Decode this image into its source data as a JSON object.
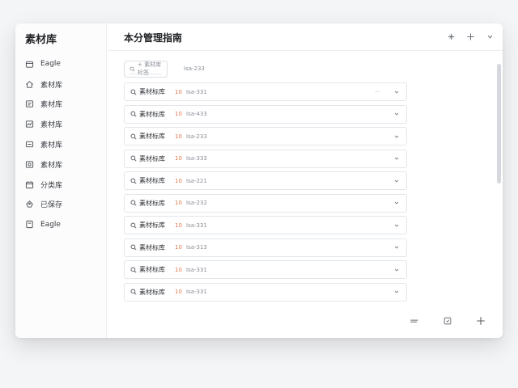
{
  "sidebar": {
    "title": "素材库",
    "items": [
      {
        "label": "Eagle",
        "icon": "folder-icon"
      },
      {
        "label": "素材库",
        "icon": "home-icon"
      },
      {
        "label": "素材库",
        "icon": "image-icon"
      },
      {
        "label": "素材库",
        "icon": "chart-icon"
      },
      {
        "label": "素材库",
        "icon": "archive-icon"
      },
      {
        "label": "素材库",
        "icon": "photo-icon"
      },
      {
        "label": "分类库",
        "icon": "calendar-icon"
      },
      {
        "label": "已保存",
        "icon": "tag-icon"
      },
      {
        "label": "Eagle",
        "icon": "document-icon"
      }
    ]
  },
  "header": {
    "title": "本分管理指南"
  },
  "filter": {
    "chip_label": "+ 素材库标签",
    "code": "Isa-233"
  },
  "rows": [
    {
      "name": "素材标库",
      "tag": "10",
      "code": "Isa-331",
      "ellipsis": "···"
    },
    {
      "name": "素材标库",
      "tag": "10",
      "code": "Isa-433",
      "ellipsis": ""
    },
    {
      "name": "素材标库",
      "tag": "10",
      "code": "Isa-233",
      "ellipsis": ""
    },
    {
      "name": "素材标库",
      "tag": "10",
      "code": "Isa-333",
      "ellipsis": ""
    },
    {
      "name": "素材标库",
      "tag": "10",
      "code": "Isa-221",
      "ellipsis": ""
    },
    {
      "name": "素材标库",
      "tag": "10",
      "code": "Isa-232",
      "ellipsis": ""
    },
    {
      "name": "素材标库",
      "tag": "10",
      "code": "Isa-331",
      "ellipsis": ""
    },
    {
      "name": "素材标库",
      "tag": "10",
      "code": "Isa-313",
      "ellipsis": ""
    },
    {
      "name": "素材标库",
      "tag": "10",
      "code": "Isa-331",
      "ellipsis": ""
    },
    {
      "name": "素材标库",
      "tag": "10",
      "code": "Isa-331",
      "ellipsis": ""
    }
  ],
  "colors": {
    "accent_tag": "#e0794f",
    "border": "#e3e6ea",
    "background": "#f4f5f7"
  }
}
